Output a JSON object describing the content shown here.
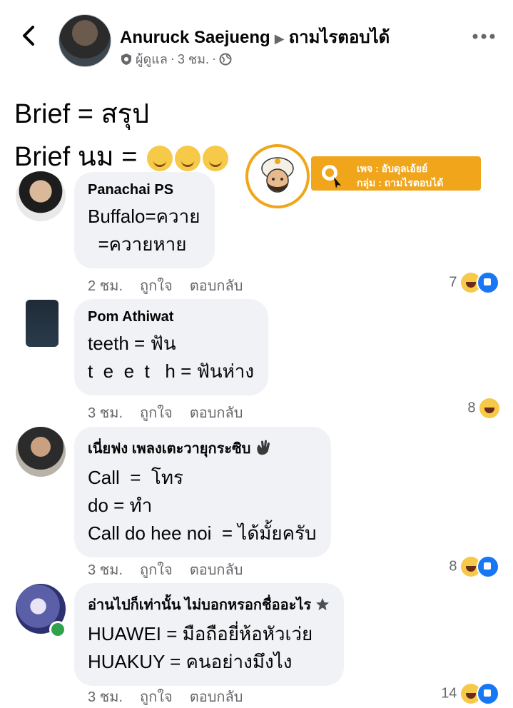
{
  "header": {
    "author": "Anuruck Saejueng",
    "group": "ถามไรตอบได้",
    "role": "ผู้ดูแล",
    "time": "3 ชม.",
    "separator": "·"
  },
  "post": {
    "lines": [
      "Brief = สรุป",
      "Brief นม ="
    ]
  },
  "watermark": {
    "page_label": "เพจ : อับดุลเอ้ยย์",
    "group_label": "กลุ่ม : ถามไรตอบได้"
  },
  "comments": [
    {
      "name": "Panachai PS",
      "lines": [
        "Buffalo=ควาย",
        "  =ควายหาย"
      ],
      "time": "2 ชม.",
      "like": "ถูกใจ",
      "reply": "ตอบกลับ",
      "reaction_count": "7",
      "reactions": [
        "haha-icon",
        "like-icon"
      ]
    },
    {
      "name": "Pom Athiwat",
      "lines": [
        "teeth = ฟัน",
        "t  e  e  t   h = ฟันห่าง"
      ],
      "time": "3 ชม.",
      "like": "ถูกใจ",
      "reply": "ตอบกลับ",
      "reaction_count": "8",
      "reactions": [
        "haha-icon"
      ]
    },
    {
      "name": "เนี่ยฟง เพลงเตะวายุกระซิบ",
      "lines": [
        "Call  =  โทร",
        "do = ทำ",
        "Call do hee noi  = ได้มั้ยครับ"
      ],
      "time": "3 ชม.",
      "like": "ถูกใจ",
      "reply": "ตอบกลับ",
      "reaction_count": "8",
      "reactions": [
        "haha-icon",
        "like-icon"
      ]
    },
    {
      "name": "อ่านไปก็เท่านั้น ไม่บอกหรอกชื่ออะไร",
      "lines": [
        "HUAWEI = มือถือยี่ห้อหัวเว่ย",
        "HUAKUY = คนอย่างมึงไง"
      ],
      "time": "3 ชม.",
      "like": "ถูกใจ",
      "reply": "ตอบกลับ",
      "reaction_count": "14",
      "reactions": [
        "haha-icon",
        "like-icon"
      ]
    }
  ],
  "colors": {
    "bubble": "#f0f2f5",
    "meta_text": "#65676b",
    "like_blue": "#1877f2",
    "haha_yellow": "#f7c948",
    "watermark_orange": "#f0a51b",
    "online_green": "#31a24c"
  }
}
